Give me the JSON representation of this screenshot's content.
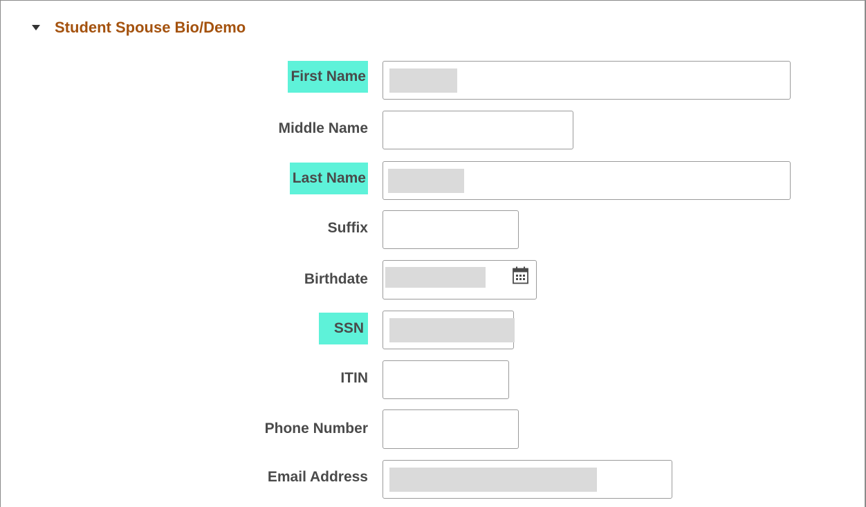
{
  "section": {
    "title": "Student Spouse Bio/Demo",
    "expander_icon": "triangle-down-icon"
  },
  "fields": {
    "first_name": {
      "label": "First Name",
      "value": "",
      "required": true
    },
    "middle_name": {
      "label": "Middle Name",
      "value": "",
      "required": false
    },
    "last_name": {
      "label": "Last Name",
      "value": "",
      "required": true
    },
    "suffix": {
      "label": "Suffix",
      "value": "",
      "required": false
    },
    "birthdate": {
      "label": "Birthdate",
      "value": "",
      "required": false,
      "icon": "calendar-icon"
    },
    "ssn": {
      "label": "SSN",
      "value": "",
      "required": true
    },
    "itin": {
      "label": "ITIN",
      "value": "",
      "required": false
    },
    "phone_number": {
      "label": "Phone Number",
      "value": "",
      "required": false
    },
    "email_address": {
      "label": "Email Address",
      "value": "",
      "required": false
    }
  },
  "colors": {
    "section_title": "#a4520e",
    "required_highlight": "#5ef2d9",
    "label_text": "#4a4a4a",
    "input_border": "#9a9a9a",
    "redaction": "#dadada"
  }
}
